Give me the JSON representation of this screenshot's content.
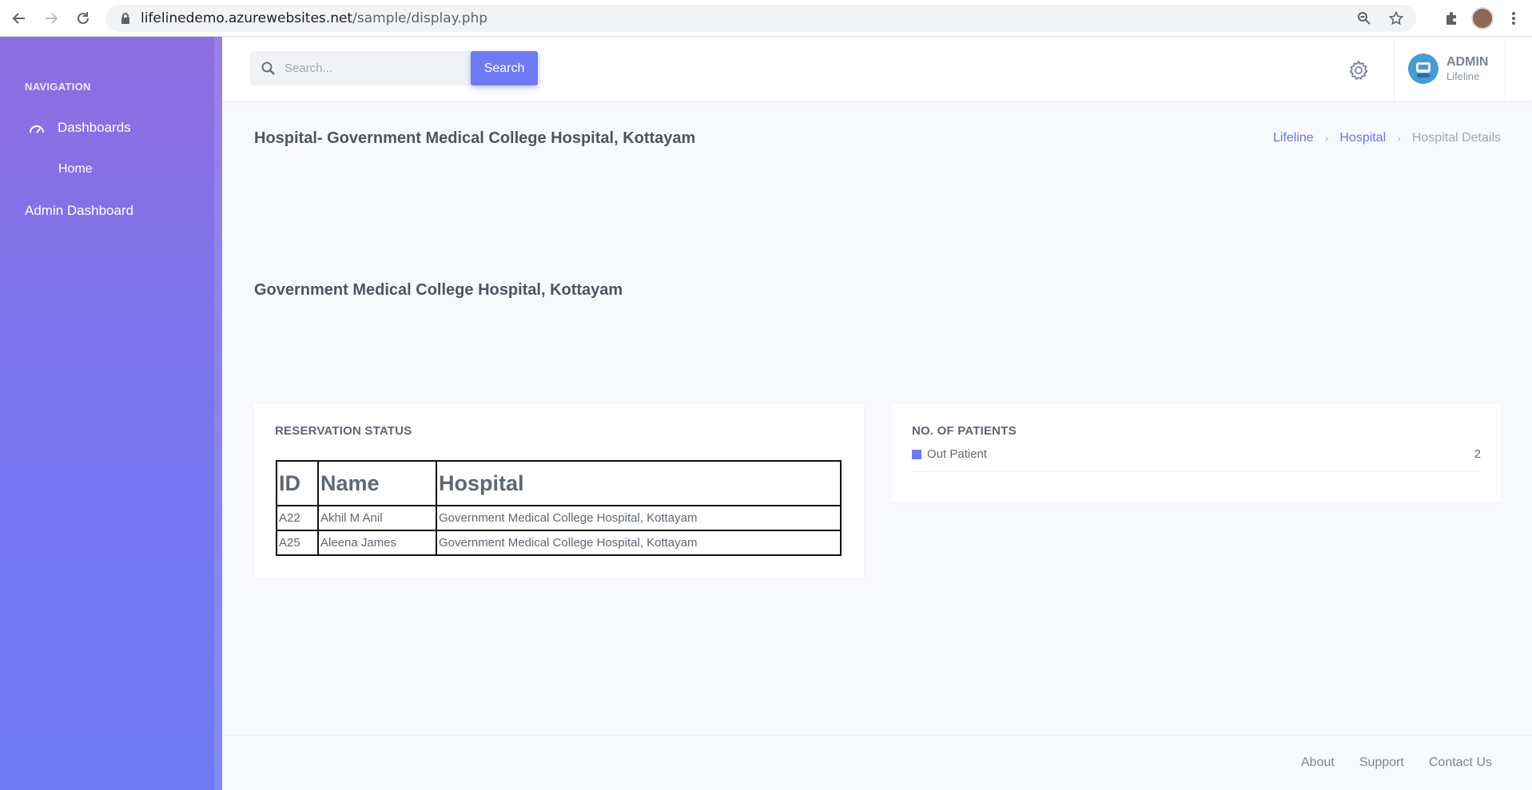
{
  "browser": {
    "url_host": "lifelinedemo.azurewebsites.net",
    "url_path": "/sample/display.php"
  },
  "sidebar": {
    "heading": "NAVIGATION",
    "items": [
      {
        "label": "Dashboards",
        "icon": "speedometer-icon"
      },
      {
        "label": "Home"
      },
      {
        "label": "Admin Dashboard"
      }
    ]
  },
  "topbar": {
    "search_placeholder": "Search...",
    "search_button": "Search",
    "user": {
      "name": "ADMIN",
      "subtitle": "Lifeline"
    }
  },
  "page": {
    "title": "Hospital- Government Medical College Hospital, Kottayam",
    "breadcrumb": [
      "Lifeline",
      "Hospital",
      "Hospital Details"
    ],
    "hospital_heading": "Government Medical College Hospital, Kottayam"
  },
  "reservation": {
    "title": "RESERVATION STATUS",
    "columns": [
      "ID",
      "Name",
      "Hospital"
    ],
    "rows": [
      [
        "A22",
        "Akhil M Anil",
        "Government Medical College Hospital, Kottayam"
      ],
      [
        "A25",
        "Aleena James",
        "Government Medical College Hospital, Kottayam"
      ]
    ]
  },
  "patients": {
    "title": "NO. OF PATIENTS",
    "legend": [
      {
        "label": "Out Patient",
        "value": "2",
        "color": "#6d7af2"
      }
    ]
  },
  "footer": {
    "links": [
      "About",
      "Support",
      "Contact Us"
    ]
  },
  "colors": {
    "accent": "#6d7af2",
    "sidebar_top": "#8e6ee0",
    "sidebar_bottom": "#6f7af5"
  }
}
